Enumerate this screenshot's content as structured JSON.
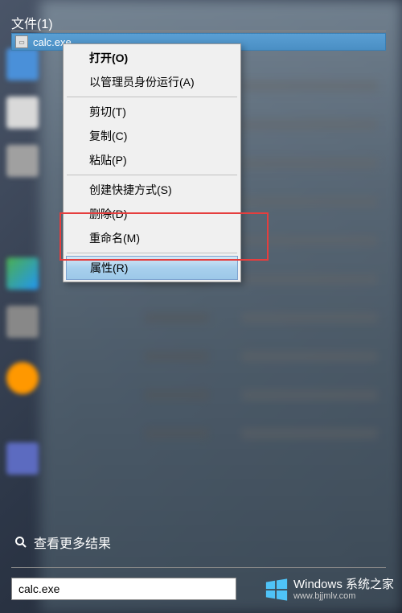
{
  "header": {
    "label": "文件(1)"
  },
  "file": {
    "name": "calc.exe",
    "icon_name": "application-icon"
  },
  "context_menu": {
    "items": [
      {
        "label": "打开(O)",
        "bold": true
      },
      {
        "label": "以管理员身份运行(A)"
      },
      {
        "separator": true
      },
      {
        "label": "剪切(T)"
      },
      {
        "label": "复制(C)"
      },
      {
        "label": "粘贴(P)"
      },
      {
        "separator": true
      },
      {
        "label": "创建快捷方式(S)"
      },
      {
        "label": "删除(D)"
      },
      {
        "label": "重命名(M)"
      },
      {
        "separator": true
      },
      {
        "label": "属性(R)",
        "highlighted": true
      }
    ]
  },
  "see_more": {
    "label": "查看更多结果"
  },
  "search": {
    "value": "calc.exe"
  },
  "watermark": {
    "top": "Windows 系统之家",
    "bottom": "www.bjjmlv.com"
  }
}
